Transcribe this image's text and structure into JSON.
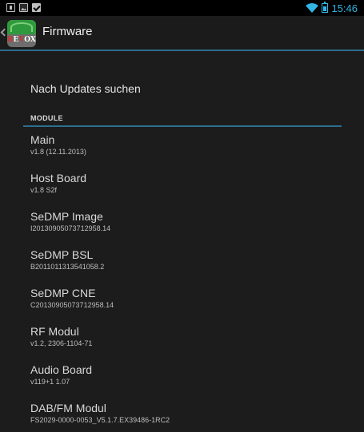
{
  "status_bar": {
    "time": "15:46",
    "left_icons": [
      "sim-icon",
      "image-icon",
      "check-icon"
    ],
    "right_icons": [
      "wifi-icon",
      "battery-icon"
    ],
    "accent": "#33b5e5"
  },
  "action_bar": {
    "title": "Firmware",
    "logo_text": "REVOX"
  },
  "check_updates_label": "Nach Updates suchen",
  "category_label": "MODULE",
  "modules": [
    {
      "title": "Main",
      "value": "v1.8  (12.11.2013)"
    },
    {
      "title": "Host Board",
      "value": "v1.8 S2f"
    },
    {
      "title": "SeDMP Image",
      "value": "I20130905073712958.14"
    },
    {
      "title": "SeDMP BSL",
      "value": "B2011011313541058.2"
    },
    {
      "title": "SeDMP CNE",
      "value": "C20130905073712958.14"
    },
    {
      "title": "RF Modul",
      "value": "v1.2, 2306-1104-71"
    },
    {
      "title": "Audio Board",
      "value": "v119+1 1.07"
    },
    {
      "title": "DAB/FM Modul",
      "value": "FS2029-0000-0053_V5.1.7.EX39486-1RC2"
    }
  ]
}
